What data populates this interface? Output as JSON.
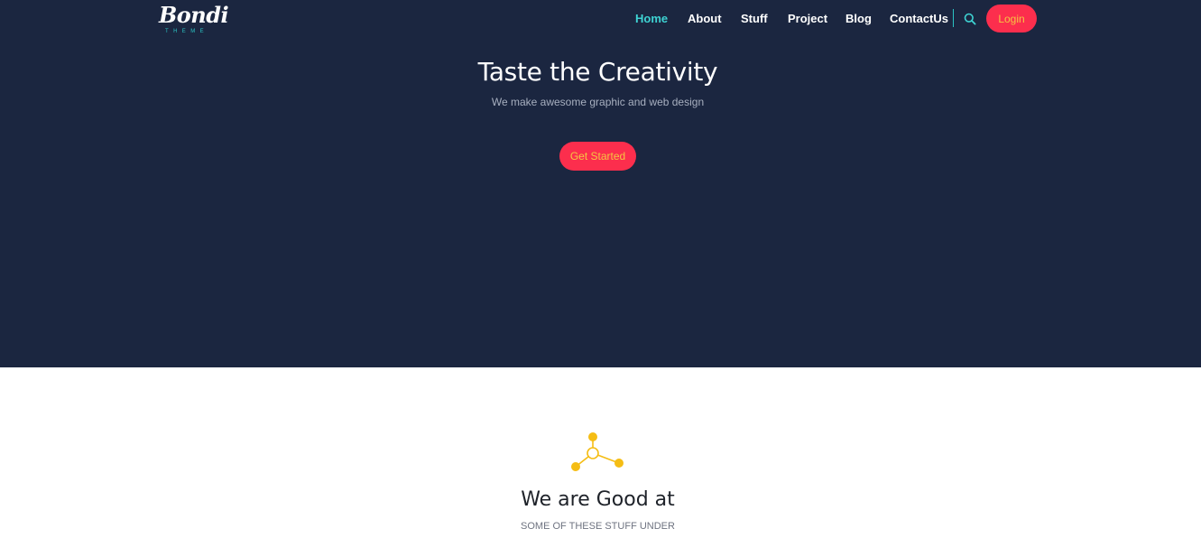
{
  "brand": {
    "logo_script": "Bondi",
    "logo_sub": "THEME"
  },
  "nav": {
    "items": [
      {
        "label": "Home",
        "active": true
      },
      {
        "label": "About",
        "active": false
      },
      {
        "label": "Stuff",
        "active": false
      },
      {
        "label": "Project",
        "active": false
      },
      {
        "label": "Blog",
        "active": false
      },
      {
        "label": "ContactUs",
        "active": false
      }
    ],
    "search_icon": "search-icon",
    "login_label": "Login"
  },
  "hero": {
    "title": "Taste the Creativity",
    "subtitle": "We make awesome graphic and web design",
    "cta_label": "Get Started"
  },
  "services": {
    "icon": "molecule-icon",
    "title": "We are Good at",
    "subtitle": "SOME OF THESE STUFF UNDER"
  },
  "colors": {
    "hero_bg": "#1b2640",
    "accent_teal": "#3ed3d3",
    "button_red": "#fc2e4d",
    "button_text": "#f5c542",
    "icon_yellow": "#f5bd14"
  }
}
